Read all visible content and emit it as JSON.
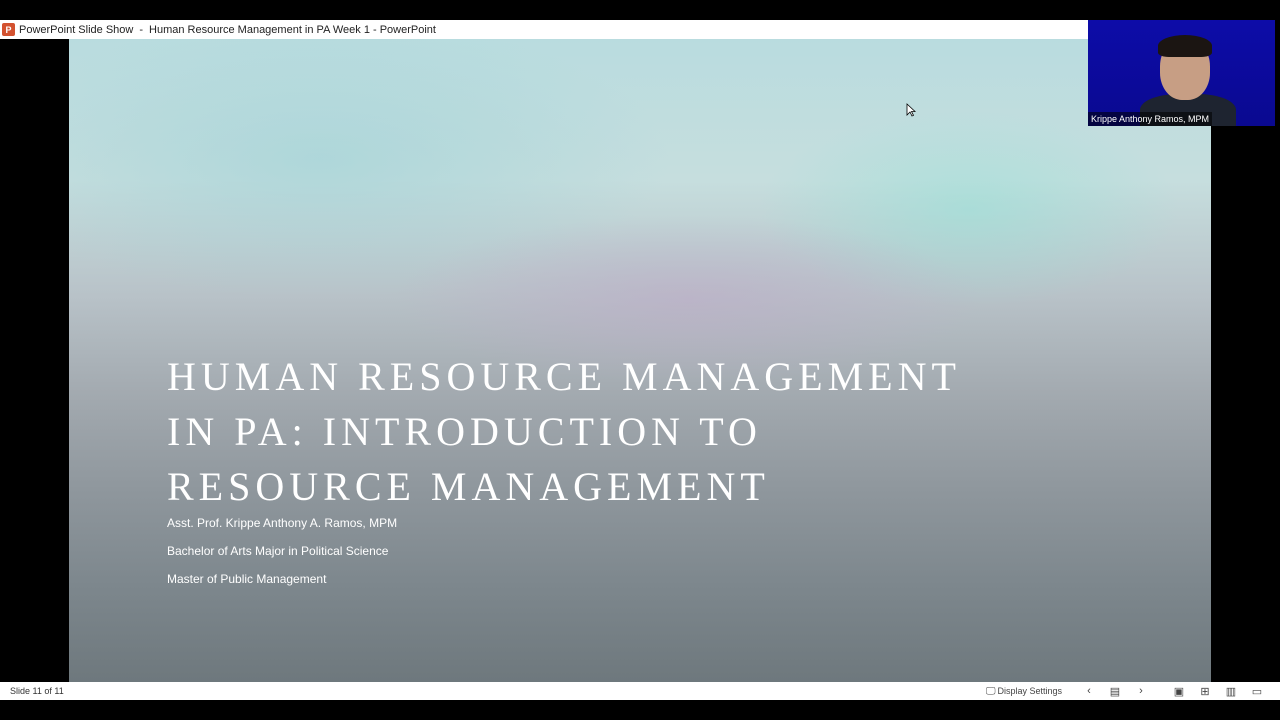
{
  "titlebar": {
    "app_name": "PowerPoint Slide Show",
    "separator": "-",
    "document_title": "Human Resource Management in PA Week 1 - PowerPoint"
  },
  "slide": {
    "title": "HUMAN RESOURCE MANAGEMENT\nIN PA: INTRODUCTION TO\nRESOURCE MANAGEMENT",
    "subtitle_lines": [
      "Asst. Prof. Krippe Anthony A. Ramos, MPM",
      "Bachelor of Arts Major in Political Science",
      "Master of Public Management"
    ]
  },
  "webcam": {
    "participant_name": "Krippe Anthony Ramos, MPM"
  },
  "statusbar": {
    "slide_counter": "Slide 11 of 11",
    "display_settings_label": "Display Settings",
    "icons": [
      "display-settings-icon",
      "previous-icon",
      "notes-icon",
      "next-icon",
      "normal-view-icon",
      "slide-sorter-icon",
      "reading-view-icon",
      "slideshow-icon"
    ]
  },
  "colors": {
    "titlebar_bg": "#ffffff",
    "webcam_bg": "#0d0ca8",
    "powerpoint_brand": "#d35230",
    "slide_text": "#ffffff"
  }
}
